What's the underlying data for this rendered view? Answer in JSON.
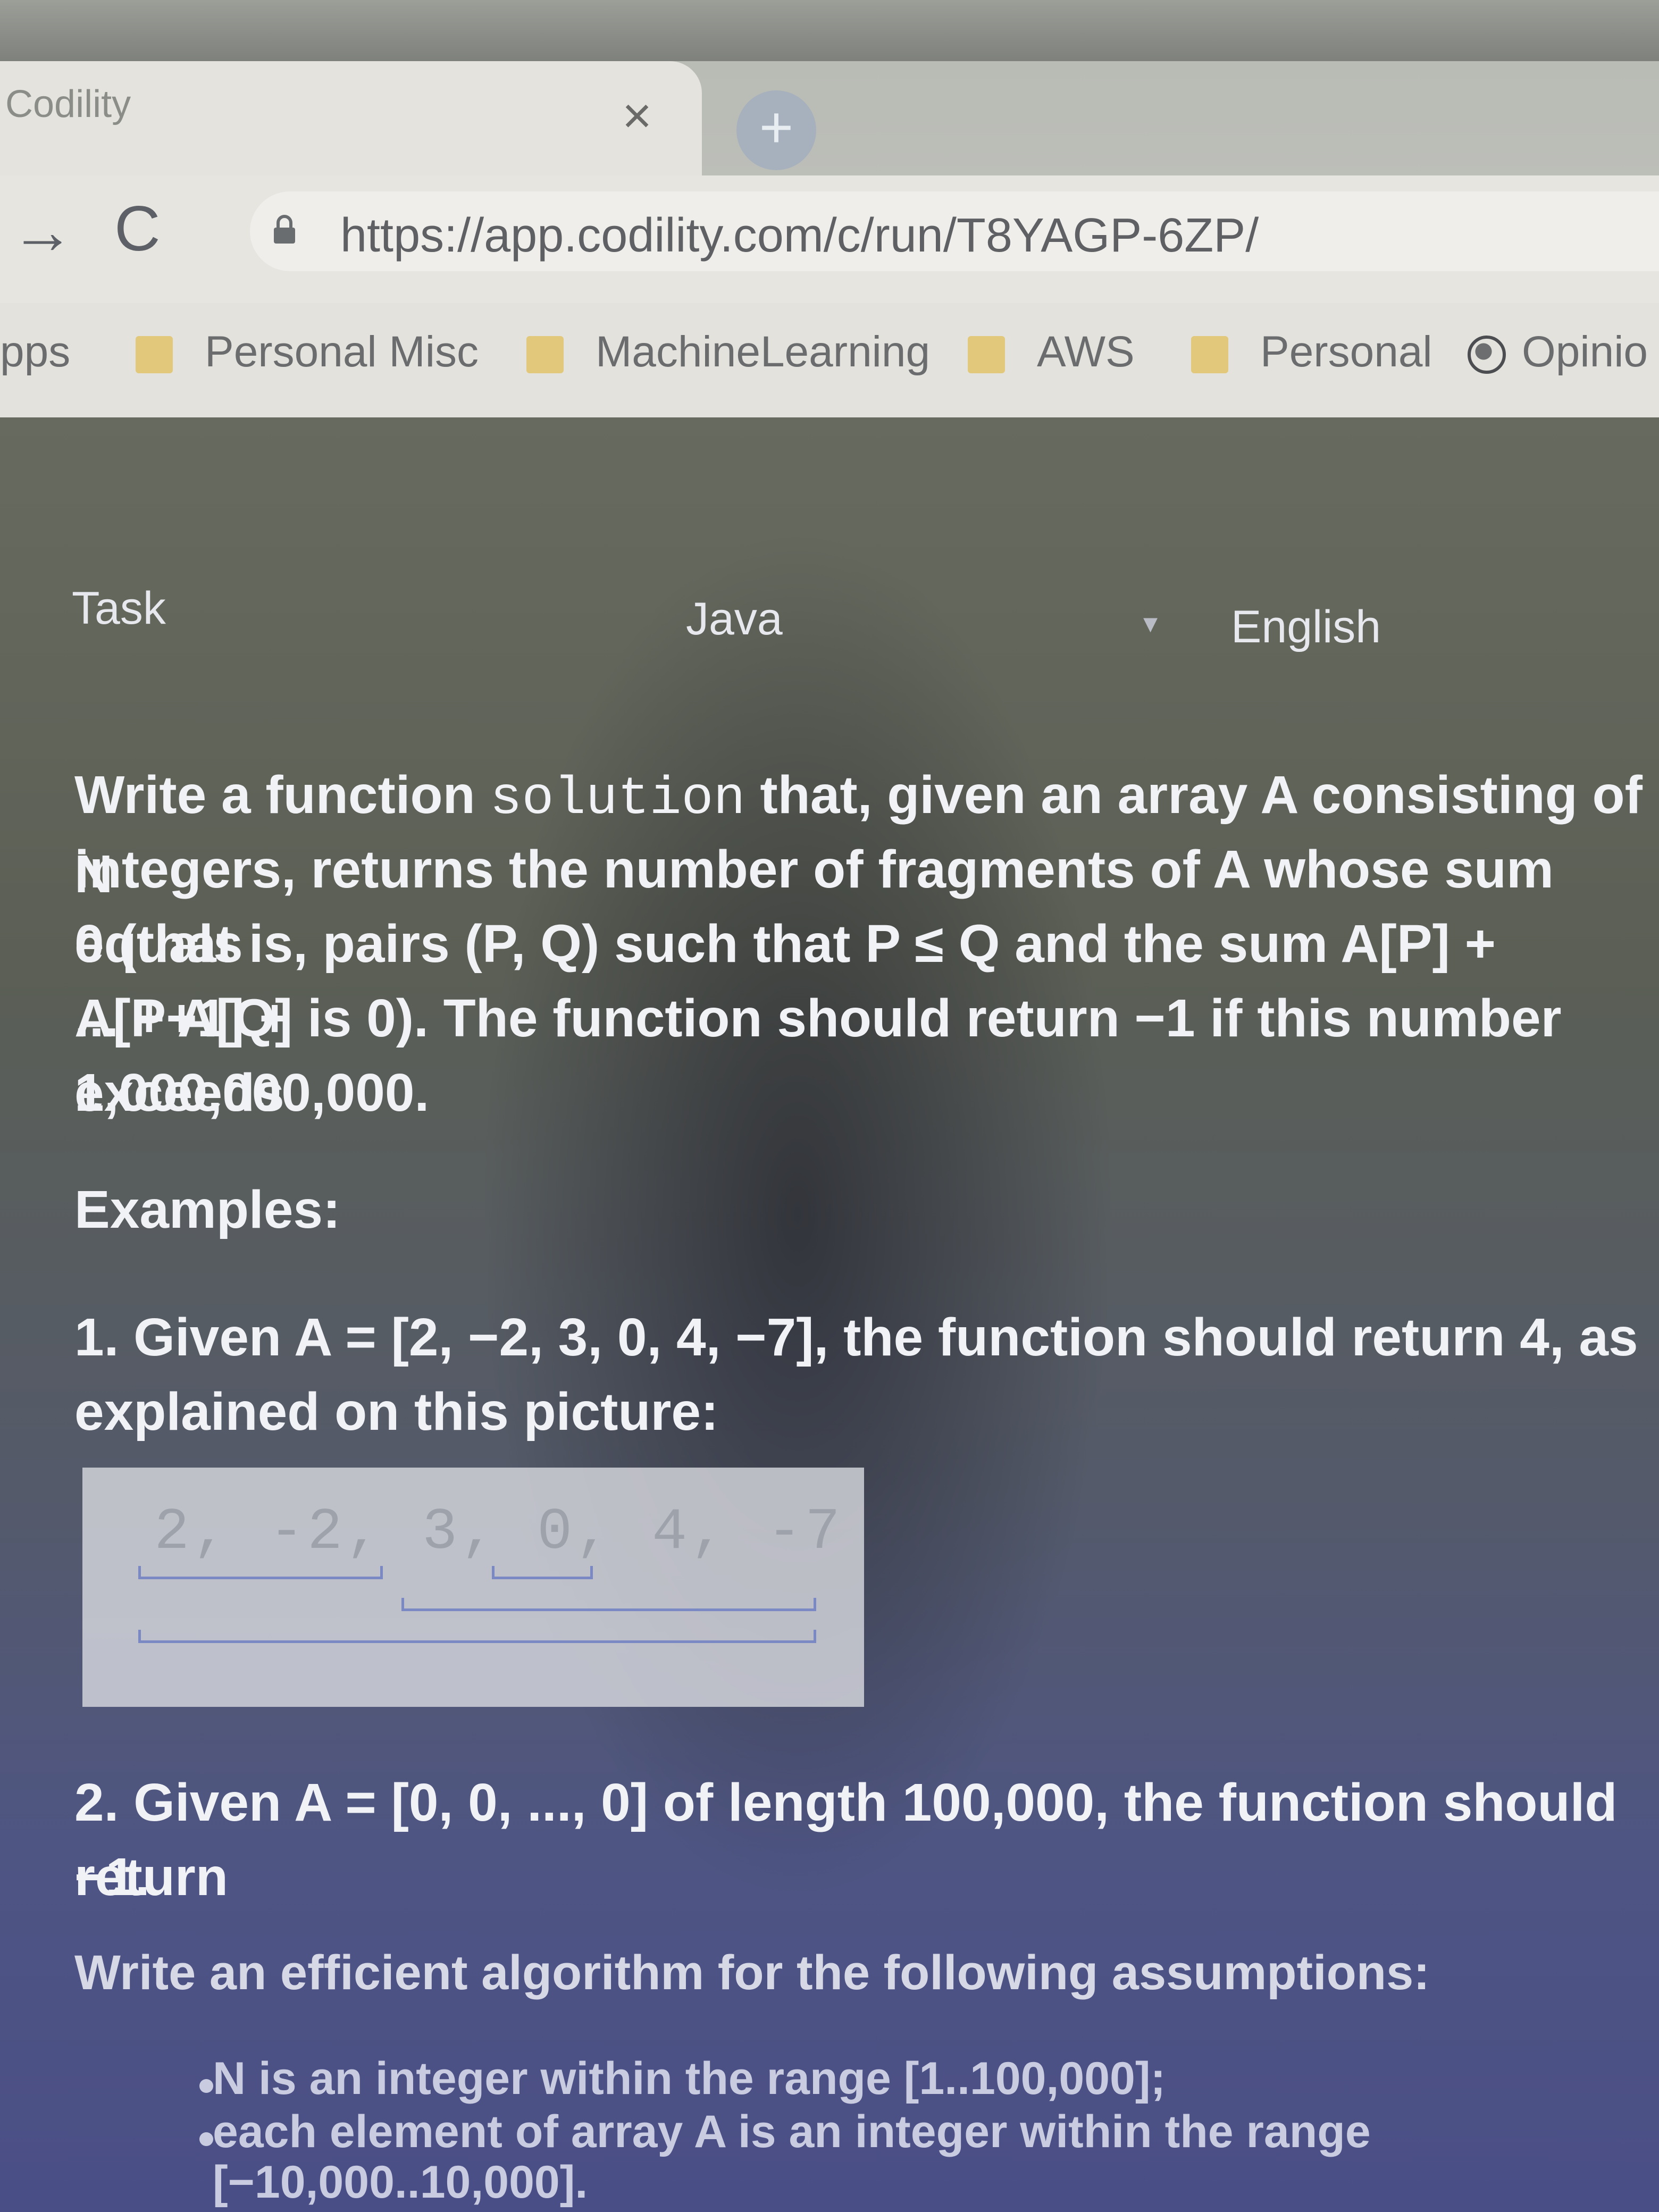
{
  "browser": {
    "tab_title": "Codility",
    "tab_close": "×",
    "new_tab": "+",
    "back_glyph": "→",
    "reload_glyph": "C",
    "url": "https://app.codility.com/c/run/T8YAGP-6ZP/",
    "bookmarks": [
      "pps",
      "Personal Misc",
      "MachineLearning",
      "AWS",
      "Personal",
      "Opinio"
    ]
  },
  "task": {
    "tab_label": "Task",
    "language": "Java",
    "locale": "English"
  },
  "statement": {
    "p1_a": "Write a function ",
    "p1_code": "solution",
    "p1_b": " that, given an array A consisting of N",
    "p1_l2": "integers, returns the number of fragments of A whose sum equals",
    "p1_l3": "0 (that is, pairs (P, Q) such that P ≤ Q and the sum A[P] + A[P+1] +",
    "p1_l4": "... + A[Q] is 0). The function should return −1 if this number exceeds",
    "p1_l5": "1,000,000,000.",
    "examples_heading": "Examples:",
    "ex1_l1": "1. Given A = [2, −2, 3, 0, 4, −7], the function should return 4, as",
    "ex1_l2": "explained on this picture:",
    "picture_array": "2, -2, 3, 0, 4, -7",
    "ex2_l1": "2. Given A = [0, 0, ..., 0] of length 100,000, the function should return",
    "ex2_l2": "−1.",
    "assumptions_heading": "Write an efficient algorithm for the following assumptions:",
    "bullet1": "N is an integer within the range [1..100,000];",
    "bullet2_l1": "each element of array A is an integer within the range",
    "bullet2_l2": "[−10,000..10,000]."
  },
  "colors": {
    "page_bg": "#5a5e52",
    "text": "#f1f2f6",
    "bracket": "#7a88c4"
  }
}
